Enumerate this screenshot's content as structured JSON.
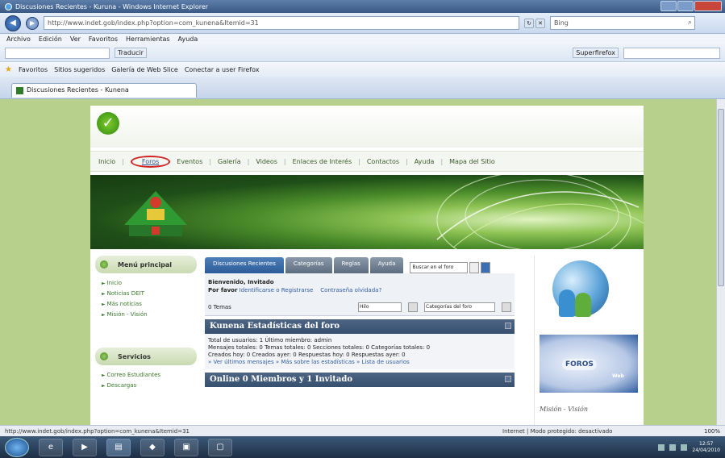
{
  "browser": {
    "title": "Discusiones Recientes - Kuruna - Windows Internet Explorer",
    "url": "http://www.indet.gob/index.php?option=com_kunena&Itemid=31",
    "search_placeholder": "Bing",
    "menu": [
      "Archivo",
      "Edición",
      "Ver",
      "Favoritos",
      "Herramientas",
      "Ayuda"
    ],
    "cmd_translate": "Traducir",
    "cmd_superfast": "Superfirefox",
    "favorites_label": "Favoritos",
    "fav_items": [
      "Sitios sugeridos",
      "Galería de Web Slice",
      "Conectar a user Firefox"
    ],
    "tab_title": "Discusiones Recientes - Kunena"
  },
  "site": {
    "nav": [
      "Inicio",
      "Foros",
      "Eventos",
      "Galería",
      "Videos",
      "Enlaces de Interés",
      "Contactos",
      "Ayuda",
      "Mapa del Sitio"
    ],
    "left": {
      "menu_title": "Menú principal",
      "menu_items": [
        "Inicio",
        "Noticias DEIT",
        "Más noticias",
        "Misión - Visión"
      ],
      "services_title": "Servicios",
      "services_items": [
        "Correo Estudiantes",
        "Descargas"
      ]
    },
    "forum": {
      "tabs": [
        "Discusiones Recientes",
        "Categorías",
        "Reglas",
        "Ayuda"
      ],
      "jump_label": "Buscar en el foro",
      "welcome_line1": "Bienvenido, Invitado",
      "welcome_line2_prefix": "Por favor",
      "login_link": "Identificarse o Registrarse",
      "forgot_link": "Contraseña olvidada?",
      "topics_label": "0 Temas",
      "filter_value": "Hilo",
      "category_value": "Categorías del foro",
      "stats_title": "Kunena Estadísticas del foro",
      "stats_line1": "Total de usuarios: 1   Último miembro: admin",
      "stats_line2": "Mensajes totales: 0   Temas totales: 0   Secciones totales: 0   Categorías totales: 0",
      "stats_line3": "Creados hoy: 0   Creados ayer: 0   Respuestas hoy: 0   Respuestas ayer: 0",
      "stats_links": "» Ver últimos mensajes » Más sobre las estadísticas » Lista de usuarios",
      "online_title": "Online 0 Miembros y 1 Invitado"
    },
    "right": {
      "foros_label": "FOROS",
      "foros_small": "Web",
      "mision_label": "Misión - Visión"
    }
  },
  "status": {
    "url": "http://www.indet.gob/index.php?option=com_kunena&Itemid=31",
    "zone": "Internet | Modo protegido: desactivado",
    "zoom": "100%"
  },
  "taskbar": {
    "clock_time": "12:57",
    "clock_date": "24/04/2010"
  },
  "colors": {
    "page_bg": "#b7d08c",
    "accent": "#2f5ea8",
    "highlight": "#d12424"
  }
}
